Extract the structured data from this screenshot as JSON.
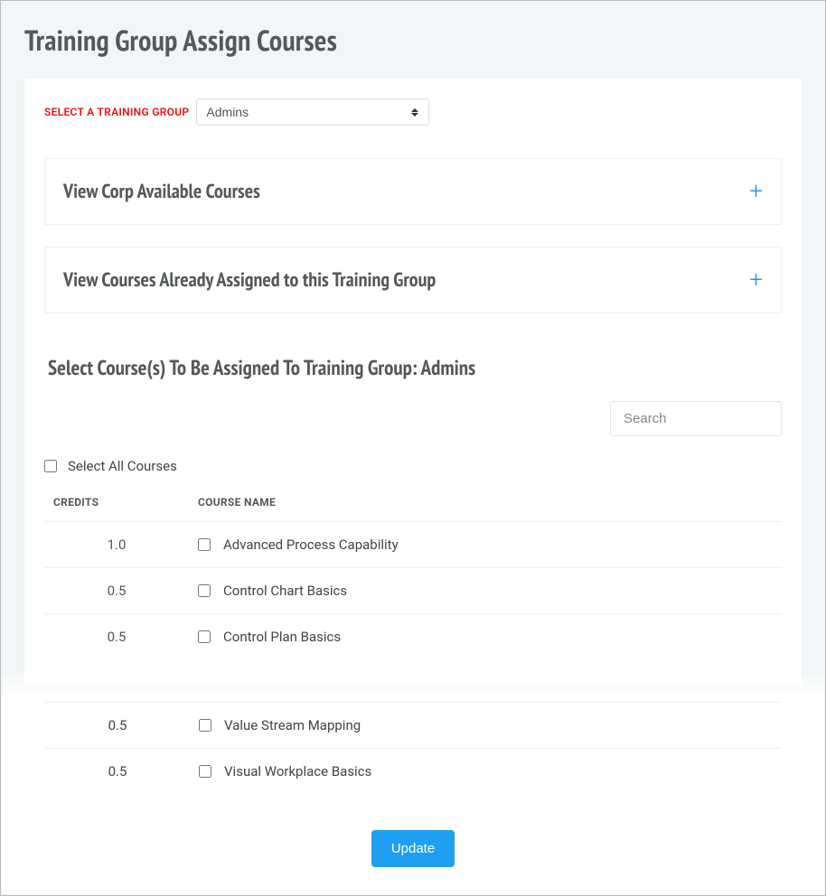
{
  "page": {
    "title": "Training Group Assign Courses"
  },
  "selector": {
    "label": "SELECT A TRAINING GROUP",
    "value": "Admins"
  },
  "accordions": [
    {
      "title": "View Corp Available Courses"
    },
    {
      "title": "View Courses Already Assigned to this Training Group"
    }
  ],
  "assign": {
    "heading": "Select Course(s) To Be Assigned To Training Group: Admins",
    "search_placeholder": "Search",
    "select_all_label": "Select All Courses"
  },
  "table": {
    "columns": {
      "credits": "CREDITS",
      "course_name": "COURSE NAME"
    },
    "rows_top": [
      {
        "credits": "1.0",
        "name": "Advanced Process Capability"
      },
      {
        "credits": "0.5",
        "name": "Control Chart Basics"
      },
      {
        "credits": "0.5",
        "name": "Control Plan Basics"
      }
    ],
    "rows_bottom": [
      {
        "credits": "0.5",
        "name": "Value Stream Mapping"
      },
      {
        "credits": "0.5",
        "name": "Visual Workplace Basics"
      }
    ]
  },
  "actions": {
    "update": "Update"
  }
}
